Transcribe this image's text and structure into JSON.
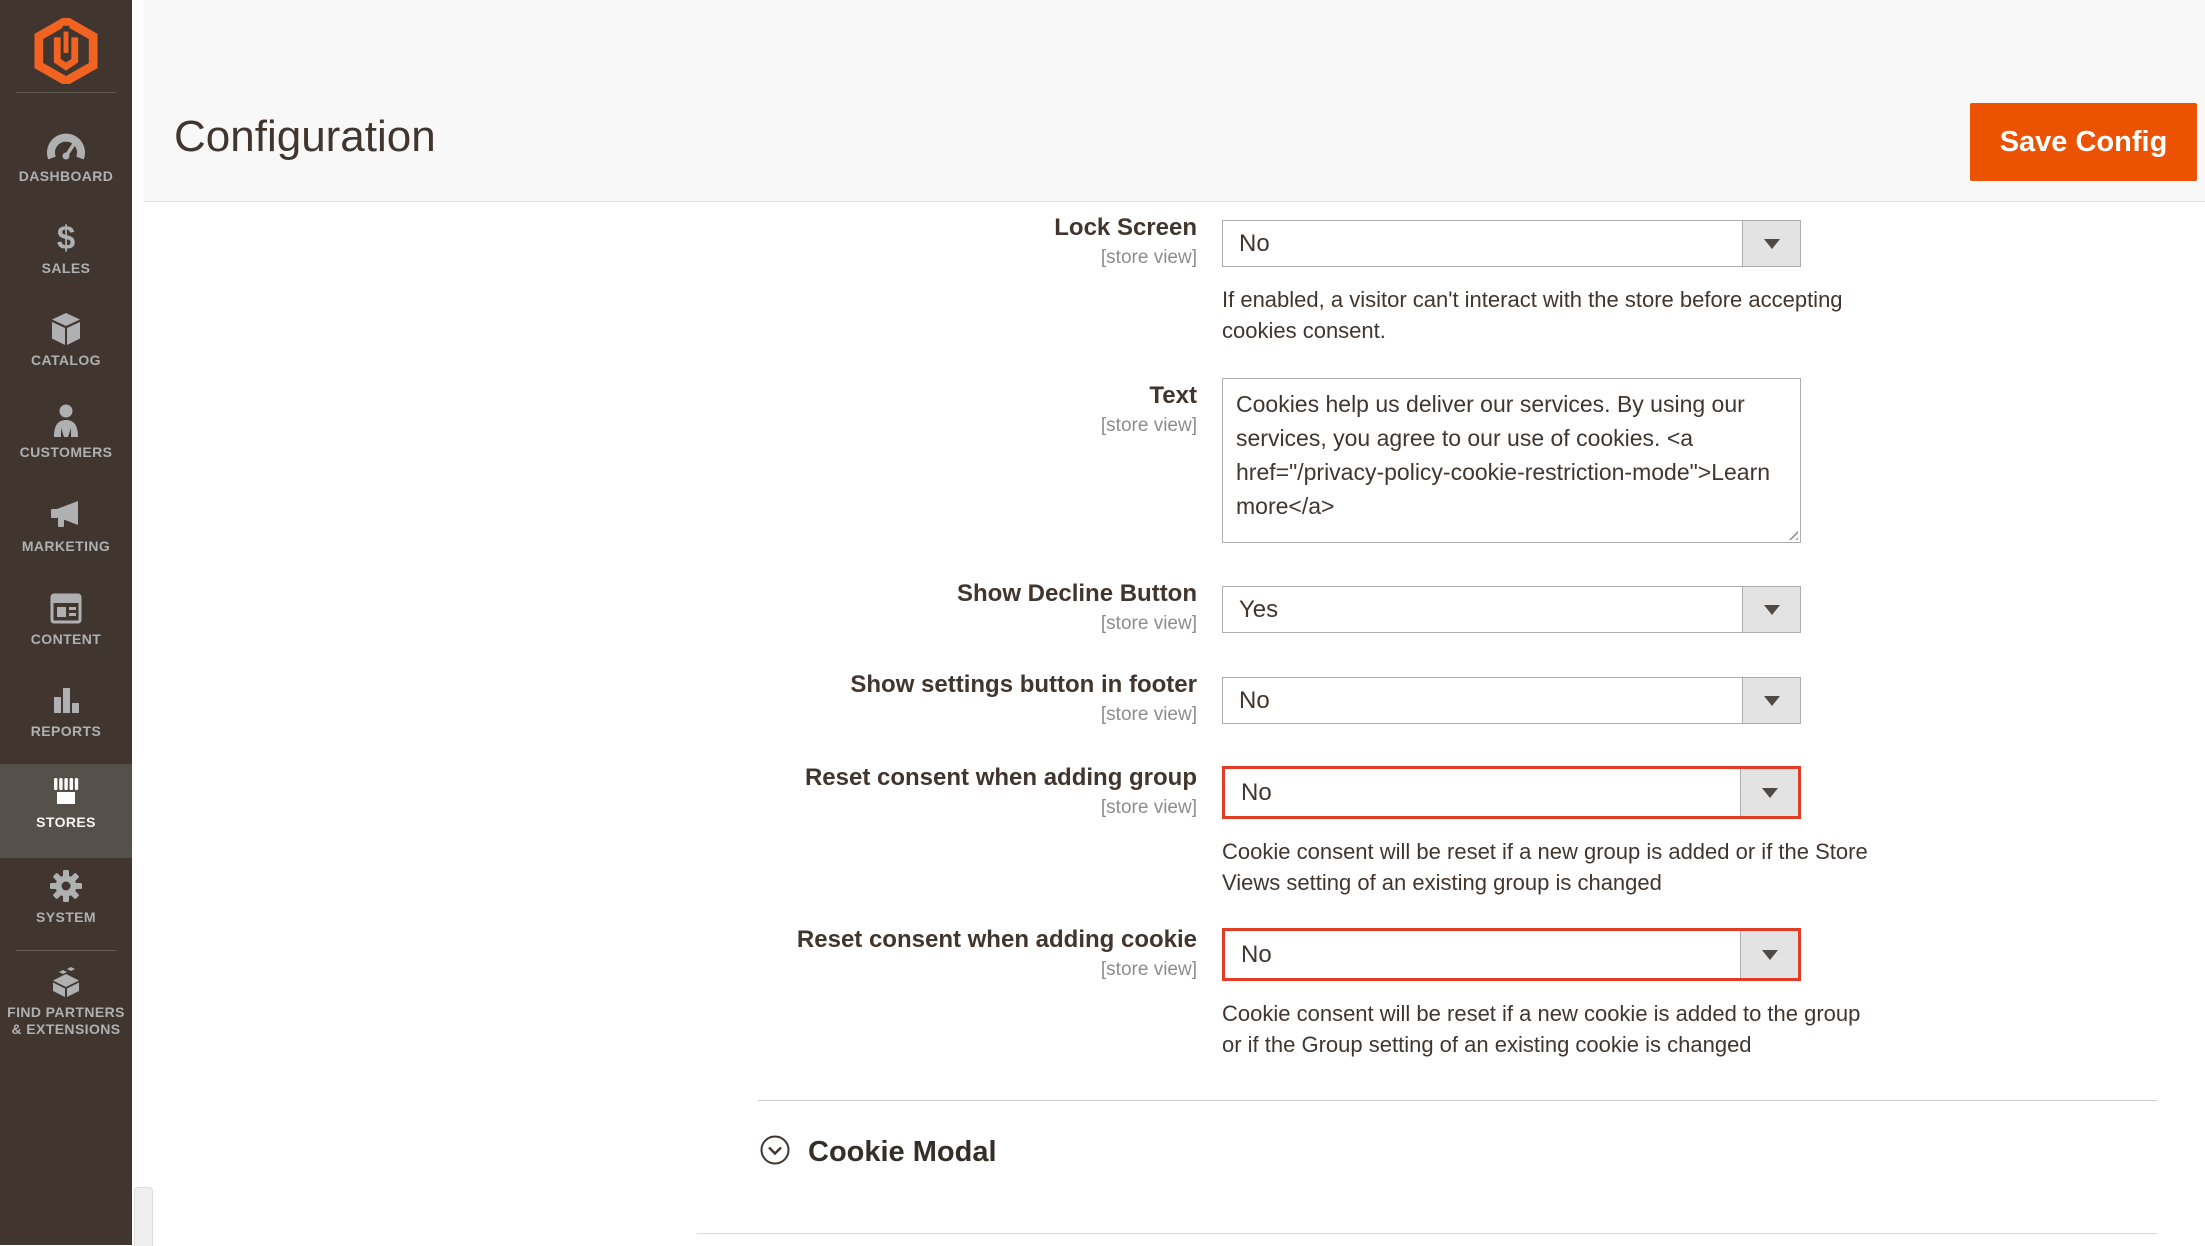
{
  "sidebar": {
    "items": [
      {
        "label": "DASHBOARD",
        "icon": "dashboard-gauge-icon",
        "active": false
      },
      {
        "label": "SALES",
        "icon": "sales-dollar-icon",
        "active": false
      },
      {
        "label": "CATALOG",
        "icon": "catalog-box-icon",
        "active": false
      },
      {
        "label": "CUSTOMERS",
        "icon": "customers-person-icon",
        "active": false
      },
      {
        "label": "MARKETING",
        "icon": "marketing-megaphone-icon",
        "active": false
      },
      {
        "label": "CONTENT",
        "icon": "content-window-icon",
        "active": false
      },
      {
        "label": "REPORTS",
        "icon": "reports-bar-chart-icon",
        "active": false
      },
      {
        "label": "STORES",
        "icon": "stores-storefront-icon",
        "active": true
      },
      {
        "label": "SYSTEM",
        "icon": "system-gear-icon",
        "active": false
      },
      {
        "label": "FIND PARTNERS & EXTENSIONS",
        "icon": "find-partners-lego-icon",
        "active": false
      }
    ]
  },
  "header": {
    "title": "Configuration",
    "save_button": "Save Config"
  },
  "form": {
    "fields": [
      {
        "label": "Lock Screen",
        "scope": "[store view]",
        "type": "select",
        "value": "No",
        "error": false,
        "note": "If enabled, a visitor can't interact with the store before accepting cookies consent."
      },
      {
        "label": "Text",
        "scope": "[store view]",
        "type": "textarea",
        "value": "Cookies help us deliver our services. By using our services, you agree to our use of cookies. <a href=\"/privacy-policy-cookie-restriction-mode\">Learn more</a>",
        "error": false,
        "note": ""
      },
      {
        "label": "Show Decline Button",
        "scope": "[store view]",
        "type": "select",
        "value": "Yes",
        "error": false,
        "note": ""
      },
      {
        "label": "Show settings button in footer",
        "scope": "[store view]",
        "type": "select",
        "value": "No",
        "error": false,
        "note": ""
      },
      {
        "label": "Reset consent when adding group",
        "scope": "[store view]",
        "type": "select",
        "value": "No",
        "error": true,
        "note": "Cookie consent will be reset if a new group is added or if the Store Views setting of an existing group is changed"
      },
      {
        "label": "Reset consent when adding cookie",
        "scope": "[store view]",
        "type": "select",
        "value": "No",
        "error": true,
        "note": "Cookie consent will be reset if a new cookie is added to the group or if the Group setting of an existing cookie is changed"
      }
    ]
  },
  "sections": {
    "cookie_modal": {
      "label": "Cookie Modal"
    }
  },
  "colors": {
    "accent_orange": "#eb5202",
    "logo_orange": "#f26322",
    "error_red": "#e23b26",
    "sidebar_bg": "#41362f",
    "sidebar_active_bg": "#56504a",
    "sidebar_icon": "#aeb0b2",
    "header_bg": "#f8f8f8",
    "input_border": "#adadad",
    "select_arrow_bg": "#e3e3e3",
    "text_dark": "#41362f"
  }
}
